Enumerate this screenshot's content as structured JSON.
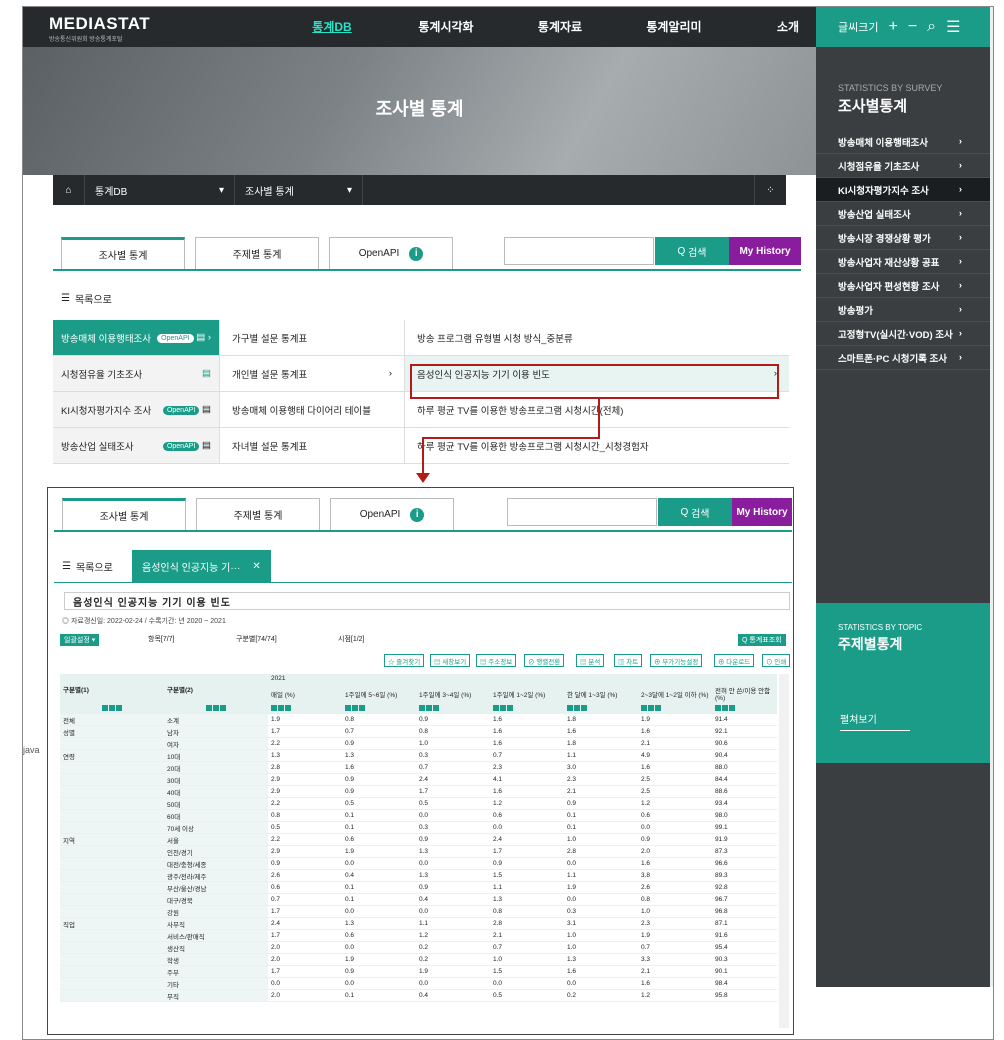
{
  "header": {
    "logo": "MEDIASTAT",
    "logo_sub": "방송통신위원회 방송통계포털",
    "nav": [
      "통계DB",
      "통계시각화",
      "통계자료",
      "통계알리미",
      "소개"
    ]
  },
  "hero": {
    "title": "조사별 통계"
  },
  "breadcrumb": {
    "home": "⌂",
    "level1": "통계DB",
    "level2": "조사별 통계"
  },
  "side": {
    "font_label": "글씨크기",
    "en": "STATISTICS BY SURVEY",
    "ko": "조사별통계",
    "items": [
      "방송매체 이용행태조사",
      "시청점유율 기초조사",
      "KI시청자평가지수 조사",
      "방송산업 실태조사",
      "방송시장 경쟁상황 평가",
      "방송사업자 재산상황 공표",
      "방송사업자 편성현황 조사",
      "방송평가",
      "고정형TV(실시간·VOD) 조사",
      "스마트폰·PC 시청기록 조사"
    ],
    "topic_en": "STATISTICS BY TOPIC",
    "topic_ko": "주제별통계",
    "topic_more": "펼쳐보기"
  },
  "tabs": {
    "t1": "조사별 통계",
    "t2": "주제별 통계",
    "t3": "OpenAPI",
    "search": "검색",
    "history": "My History"
  },
  "list": {
    "label": "목록으로"
  },
  "grid": {
    "rows": [
      {
        "c1": "방송매체 이용행태조사",
        "c2": "가구별 설문 통계표",
        "c3": "방송 프로그램 유형별 시청 방식_중분류"
      },
      {
        "c1": "시청점유율 기초조사",
        "c2": "개인별 설문 통계표",
        "c3": "음성인식 인공지능 기기 이용 빈도"
      },
      {
        "c1": "KI시청자평가지수 조사",
        "c2": "방송매체 이용행태 다이어리 테이블",
        "c3": "하루 평균 TV를 이용한 방송프로그램 시청시간(전체)"
      },
      {
        "c1": "방송산업 실태조사",
        "c2": "자녀별 설문 통계표",
        "c3": "하루 평균 TV를 이용한 방송프로그램 시청시간_시청경험자"
      }
    ],
    "openapi": "OpenAPI"
  },
  "panel": {
    "tab_title": "음성인식 인공지능 기···",
    "report_title": "음성인식 인공지능 기기 이용 빈도",
    "meta": "◎ 자료갱신일: 2022-02-24 / 수록기간: 년 2020 ~ 2021",
    "ctrl": {
      "setting": "일괄설정 ▾",
      "item": "항목[7/7]",
      "cls": "구분별[74/74]",
      "time": "시점[1/2]",
      "lookup": "Q 통계표조회"
    },
    "tools": [
      "☆ 즐겨찾기",
      "▤ 새창보기",
      "▤ 주소정보",
      "⊘ 행렬전환",
      "▤ 분석",
      "▥ 차트",
      "⊕ 부가기능설정",
      "⊕ 다운로드",
      "⊙ 인쇄"
    ],
    "year": "2021",
    "headers": [
      "구분별(1)",
      "구분별(2)",
      "매일 (%)",
      "1주일에 5~6일 (%)",
      "1주일에 3~4일 (%)",
      "1주일에 1~2일 (%)",
      "한 달에 1~3일 (%)",
      "2~3달에 1~2일 이하 (%)",
      "전혀 안 쓴/이용 안함 (%)"
    ],
    "rows": [
      [
        "전체",
        "소계",
        "1.9",
        "0.8",
        "0.9",
        "1.6",
        "1.8",
        "1.9",
        "91.4"
      ],
      [
        "성별",
        "남자",
        "1.7",
        "0.7",
        "0.8",
        "1.6",
        "1.6",
        "1.6",
        "92.1"
      ],
      [
        "",
        "여자",
        "2.2",
        "0.9",
        "1.0",
        "1.6",
        "1.8",
        "2.1",
        "90.6"
      ],
      [
        "연령",
        "10대",
        "1.3",
        "1.3",
        "0.3",
        "0.7",
        "1.1",
        "4.9",
        "90.4"
      ],
      [
        "",
        "20대",
        "2.8",
        "1.6",
        "0.7",
        "2.3",
        "3.0",
        "1.6",
        "88.0"
      ],
      [
        "",
        "30대",
        "2.9",
        "0.9",
        "2.4",
        "4.1",
        "2.3",
        "2.5",
        "84.4"
      ],
      [
        "",
        "40대",
        "2.9",
        "0.9",
        "1.7",
        "1.6",
        "2.1",
        "2.5",
        "88.6"
      ],
      [
        "",
        "50대",
        "2.2",
        "0.5",
        "0.5",
        "1.2",
        "0.9",
        "1.2",
        "93.4"
      ],
      [
        "",
        "60대",
        "0.8",
        "0.1",
        "0.0",
        "0.6",
        "0.1",
        "0.6",
        "98.0"
      ],
      [
        "",
        "70세 이상",
        "0.5",
        "0.1",
        "0.3",
        "0.0",
        "0.1",
        "0.0",
        "99.1"
      ],
      [
        "지역",
        "서울",
        "2.2",
        "0.6",
        "0.9",
        "2.4",
        "1.0",
        "0.9",
        "91.9"
      ],
      [
        "",
        "인천/경기",
        "2.9",
        "1.9",
        "1.3",
        "1.7",
        "2.8",
        "2.0",
        "87.3"
      ],
      [
        "",
        "대전/충청/세종",
        "0.9",
        "0.0",
        "0.0",
        "0.9",
        "0.0",
        "1.6",
        "96.6"
      ],
      [
        "",
        "광주/전라/제주",
        "2.6",
        "0.4",
        "1.3",
        "1.5",
        "1.1",
        "3.8",
        "89.3"
      ],
      [
        "",
        "부산/울산/경남",
        "0.6",
        "0.1",
        "0.9",
        "1.1",
        "1.9",
        "2.6",
        "92.8"
      ],
      [
        "",
        "대구/경북",
        "0.7",
        "0.1",
        "0.4",
        "1.3",
        "0.0",
        "0.8",
        "96.7"
      ],
      [
        "",
        "강원",
        "1.7",
        "0.0",
        "0.0",
        "0.8",
        "0.3",
        "1.0",
        "96.8"
      ],
      [
        "직업",
        "사무직",
        "2.4",
        "1.3",
        "1.1",
        "2.8",
        "3.1",
        "2.3",
        "87.1"
      ],
      [
        "",
        "서비스/판매직",
        "1.7",
        "0.6",
        "1.2",
        "2.1",
        "1.0",
        "1.9",
        "91.6"
      ],
      [
        "",
        "생산직",
        "2.0",
        "0.0",
        "0.2",
        "0.7",
        "1.0",
        "0.7",
        "95.4"
      ],
      [
        "",
        "학생",
        "2.0",
        "1.9",
        "0.2",
        "1.0",
        "1.3",
        "3.3",
        "90.3"
      ],
      [
        "",
        "주부",
        "1.7",
        "0.9",
        "1.9",
        "1.5",
        "1.6",
        "2.1",
        "90.1"
      ],
      [
        "",
        "기타",
        "0.0",
        "0.0",
        "0.0",
        "0.0",
        "0.0",
        "1.6",
        "98.4"
      ],
      [
        "",
        "무직",
        "2.0",
        "0.1",
        "0.4",
        "0.5",
        "0.2",
        "1.2",
        "95.8"
      ]
    ]
  },
  "java": "java"
}
